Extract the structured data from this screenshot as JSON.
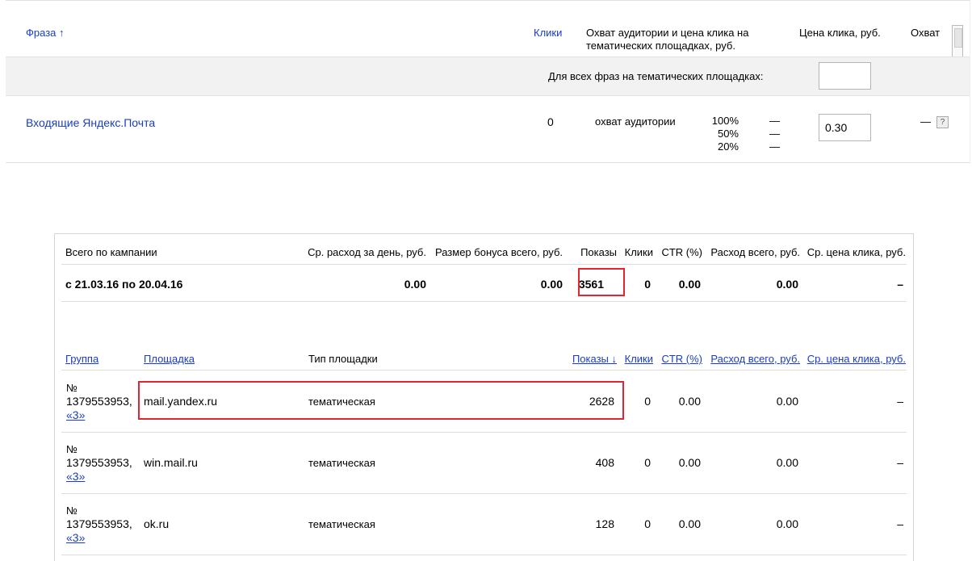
{
  "top": {
    "headers": {
      "phrase": "Фраза ↑",
      "clicks": "Клики",
      "reach_line1": "Охват аудитории и цена клика на",
      "reach_line2": "тематических площадках, руб.",
      "price": "Цена клика, руб.",
      "coverage": "Охват"
    },
    "all_phrases_label": "Для всех фраз на тематических площадках:",
    "all_phrases_value": "",
    "row": {
      "phrase": "Входящие Яндекс.Почта",
      "clicks": "0",
      "reach_label": "охват аудитории",
      "reach_levels": [
        "100%",
        "50%",
        "20%"
      ],
      "reach_values": [
        "—",
        "—",
        "—"
      ],
      "price": "0.30",
      "coverage": "—"
    },
    "help_label": "?"
  },
  "bottom": {
    "summary_headers": {
      "total": "Всего по кампании",
      "avg_daily": "Ср. расход за день, руб.",
      "bonus": "Размер бонуса всего, руб.",
      "shows": "Показы",
      "clicks": "Клики",
      "ctr": "CTR (%)",
      "spend": "Расход всего, руб.",
      "avg_cpc": "Ср. цена клика, руб."
    },
    "summary_row": {
      "period": "с 21.03.16 по 20.04.16",
      "avg_daily": "0.00",
      "bonus": "0.00",
      "shows": "3561",
      "clicks": "0",
      "ctr": "0.00",
      "spend": "0.00",
      "avg_cpc": "–"
    },
    "table_headers": {
      "group": "Группа",
      "site": "Площадка",
      "site_type": "Тип площадки",
      "shows": "Показы ↓",
      "clicks": "Клики",
      "ctr": "CTR (%)",
      "spend": "Расход всего, руб.",
      "avg_cpc": "Ср. цена клика, руб."
    },
    "rows": [
      {
        "group_no": "№",
        "group_id": "1379553953,",
        "group_link": "«3»",
        "site": "mail.yandex.ru",
        "site_type": "тематическая",
        "shows": "2628",
        "clicks": "0",
        "ctr": "0.00",
        "spend": "0.00",
        "avg_cpc": "–"
      },
      {
        "group_no": "№",
        "group_id": "1379553953,",
        "group_link": "«3»",
        "site": "win.mail.ru",
        "site_type": "тематическая",
        "shows": "408",
        "clicks": "0",
        "ctr": "0.00",
        "spend": "0.00",
        "avg_cpc": "–"
      },
      {
        "group_no": "№",
        "group_id": "1379553953,",
        "group_link": "«3»",
        "site": "ok.ru",
        "site_type": "тематическая",
        "shows": "128",
        "clicks": "0",
        "ctr": "0.00",
        "spend": "0.00",
        "avg_cpc": "–"
      }
    ]
  },
  "colors": {
    "link": "#1a3dc1",
    "highlight": "#e0262e"
  }
}
